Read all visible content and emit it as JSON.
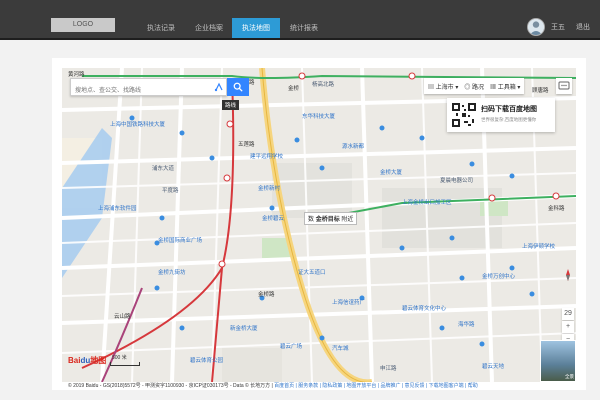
{
  "topbar": {
    "logo": "LOGO",
    "tabs": [
      {
        "label": "执法记录"
      },
      {
        "label": "企业档案"
      },
      {
        "label": "执法地图"
      },
      {
        "label": "统计报表"
      }
    ],
    "active_tab": 2,
    "user_name": "王五",
    "logout": "退出",
    "colors": {
      "bar": "#3b3b3b",
      "active": "#2d9bd6"
    }
  },
  "map": {
    "search": {
      "placeholder": "搜地点、查公交、找路线",
      "route_tooltip": "路线"
    },
    "city_bar": {
      "city": "上海市",
      "traffic": "路况",
      "toolbox": "工具箱"
    },
    "qr_card": {
      "title": "扫码下载百度地图",
      "subtitle": "世界很复杂,百度地图更懂你"
    },
    "poi": {
      "prefix": "数",
      "name": "金桥目标",
      "suffix": "附近"
    },
    "labels": [
      {
        "text": "黄河路"
      },
      {
        "text": "东陆路"
      },
      {
        "text": "金桥"
      },
      {
        "text": "五莲路"
      },
      {
        "text": "顾唐路"
      },
      {
        "text": "杨高北路"
      },
      {
        "text": "上海中国铁路科技大厦"
      },
      {
        "text": "东华科技大厦"
      },
      {
        "text": "建平远翔学校"
      },
      {
        "text": "源水新都"
      },
      {
        "text": "金桥大厦"
      },
      {
        "text": "金桥新村"
      },
      {
        "text": "金桥碧云"
      },
      {
        "text": "金桥国际商业广场"
      },
      {
        "text": "碧云体育公园"
      },
      {
        "text": "上海浦东软件园"
      },
      {
        "text": "金桥九街坊"
      },
      {
        "text": "新金桥大厦"
      },
      {
        "text": "金科路"
      },
      {
        "text": "上海金桥出口加工区"
      },
      {
        "text": "夏晨电器公司"
      },
      {
        "text": "金桥万创中心"
      },
      {
        "text": "云山路"
      },
      {
        "text": "上海伊顿学校"
      },
      {
        "text": "证大五道口"
      },
      {
        "text": "上海信谊药厂"
      },
      {
        "text": "金桥路"
      },
      {
        "text": "碧云体育文化中心"
      },
      {
        "text": "碧云广场"
      },
      {
        "text": "浦东大道"
      },
      {
        "text": "汽车城"
      },
      {
        "text": "海华路"
      },
      {
        "text": "碧云天地"
      },
      {
        "text": "申江路"
      },
      {
        "text": "平度路"
      }
    ],
    "zoom_level": "29",
    "zoom_in": "+",
    "zoom_out": "−",
    "scale": "500 米",
    "baidu_logo_a": "Bai",
    "baidu_logo_b": "du",
    "baidu_logo_c": "地图",
    "copyright": "© 2019 Baidu - GS(2018)5572号 - 甲测资字1100930 - 京ICP证030173号 - Data © 长地万方 |",
    "copyright_links": "百度首页 | 服务条款 | 隐私政策 | 地图开放平台 | 品牌推广 | 意见反馈 | 下载地图客户端 | 帮助",
    "pano_label": "全景",
    "colors": {
      "metro_green": "#3eb060",
      "metro_red": "#d6383c",
      "metro_yellow": "#f2c44d",
      "metro_purple": "#a9437a",
      "road_yellow": "#f6d57e"
    }
  }
}
